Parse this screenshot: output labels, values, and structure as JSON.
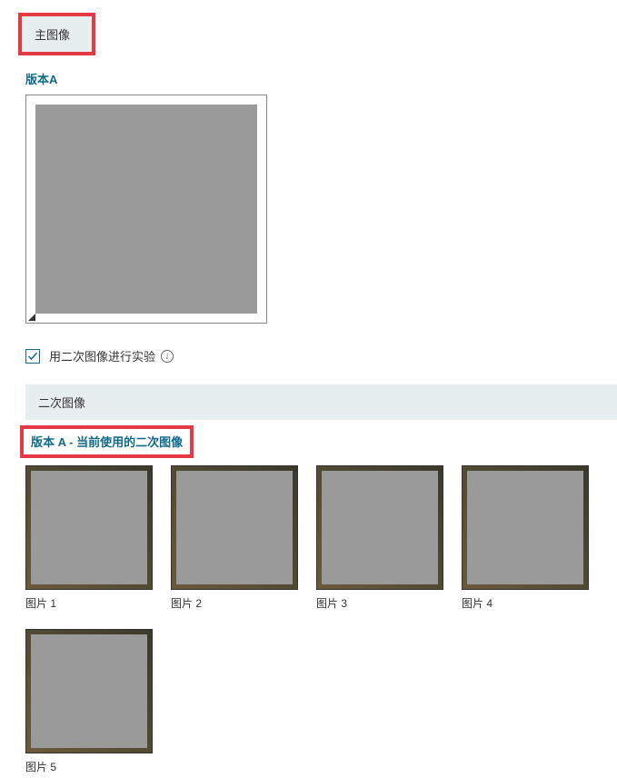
{
  "main_section": {
    "header": "主图像",
    "version_label": "版本A"
  },
  "checkbox": {
    "label": "用二次图像进行实验",
    "checked": true
  },
  "secondary_section": {
    "header": "二次图像",
    "sub_label": "版本 A - 当前使用的二次图像"
  },
  "thumbnails": [
    {
      "label": "图片 1"
    },
    {
      "label": "图片 2"
    },
    {
      "label": "图片 3"
    },
    {
      "label": "图片 4"
    },
    {
      "label": "图片 5"
    }
  ]
}
